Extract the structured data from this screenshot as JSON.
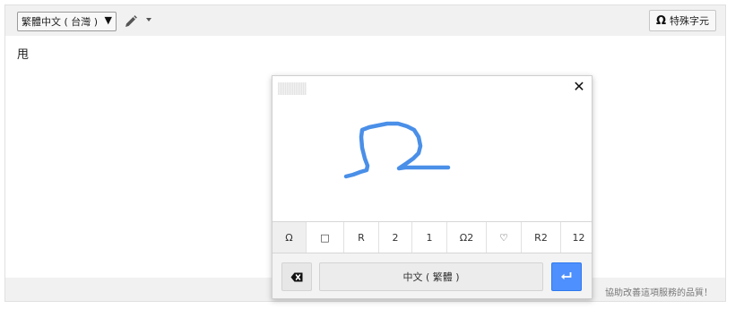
{
  "toolbar": {
    "language": "繁體中文 ( 台灣 )",
    "language_arrow": "▼",
    "special_chars_icon": "Ω",
    "special_chars_label": "特殊字元"
  },
  "editor": {
    "text": "甩"
  },
  "footer": {
    "note": "協助改善這項服務的品質！"
  },
  "handwriting": {
    "close": "✕",
    "candidates": [
      "Ω",
      "□",
      "R",
      "2",
      "1",
      "Ω2",
      "♡",
      "R2",
      "12"
    ],
    "ime_label": "中文 ( 繁體 )"
  },
  "colors": {
    "ink": "#4a8fe8",
    "enter_button": "#4d90fe"
  },
  "icons": {
    "pen": "pencil-icon",
    "backspace": "backspace-icon",
    "enter": "enter-icon",
    "close": "close-icon"
  }
}
